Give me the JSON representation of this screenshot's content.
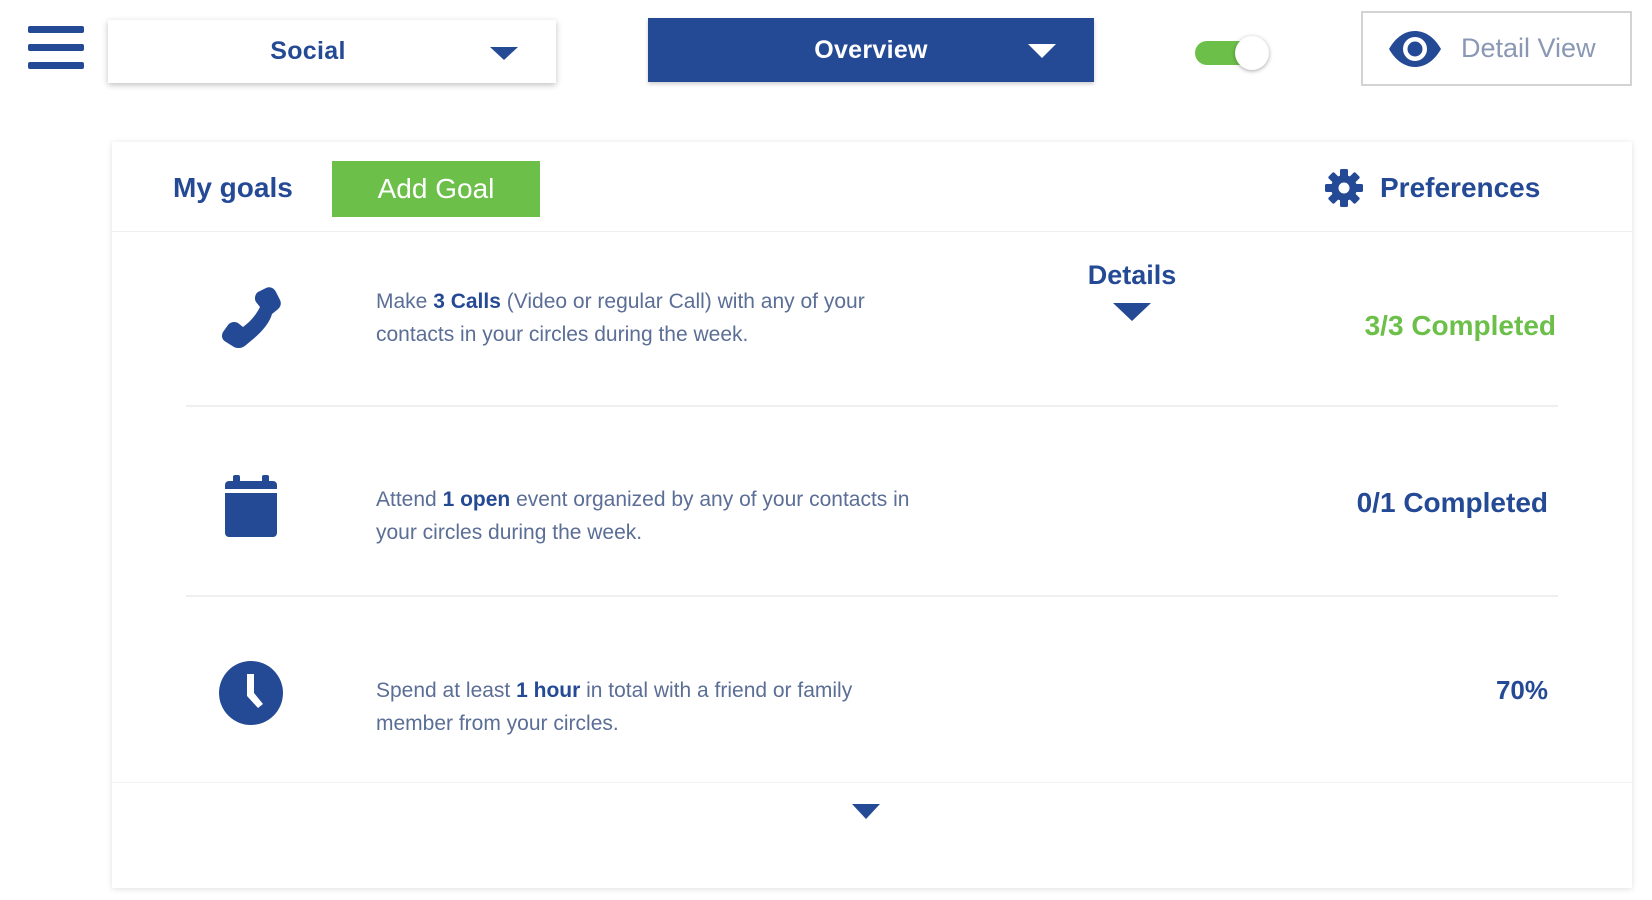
{
  "topbar": {
    "category_dropdown": {
      "selected": "Social"
    },
    "view_dropdown": {
      "selected": "Overview"
    },
    "toggle": {
      "state": "on",
      "color": "#6cc04a"
    },
    "detail_view": {
      "label": "Detail View"
    }
  },
  "goals": {
    "title": "My goals",
    "add_label": "Add Goal",
    "preferences_label": "Preferences",
    "details_label": "Details",
    "items": [
      {
        "icon": "phone-icon",
        "text_before": "Make ",
        "text_bold": "3 Calls",
        "text_after": " (Video or regular Call) with any of your contacts in your circles during the week.",
        "status": "3/3 Completed",
        "status_color": "#6cc04a"
      },
      {
        "icon": "calendar-icon",
        "text_before": "Attend ",
        "text_bold": "1 open",
        "text_after": " event organized by any of your contacts in your circles during the week.",
        "status": "0/1 Completed",
        "status_color": "#254a95"
      },
      {
        "icon": "clock-icon",
        "text_before": "Spend at least ",
        "text_bold": "1 hour",
        "text_after": " in total with a friend or family member from your circles.",
        "status": "70%",
        "status_color": "#254a95"
      }
    ]
  },
  "colors": {
    "primary": "#254a95",
    "accent_green": "#6cc04a",
    "muted_text": "#5b6e96"
  }
}
